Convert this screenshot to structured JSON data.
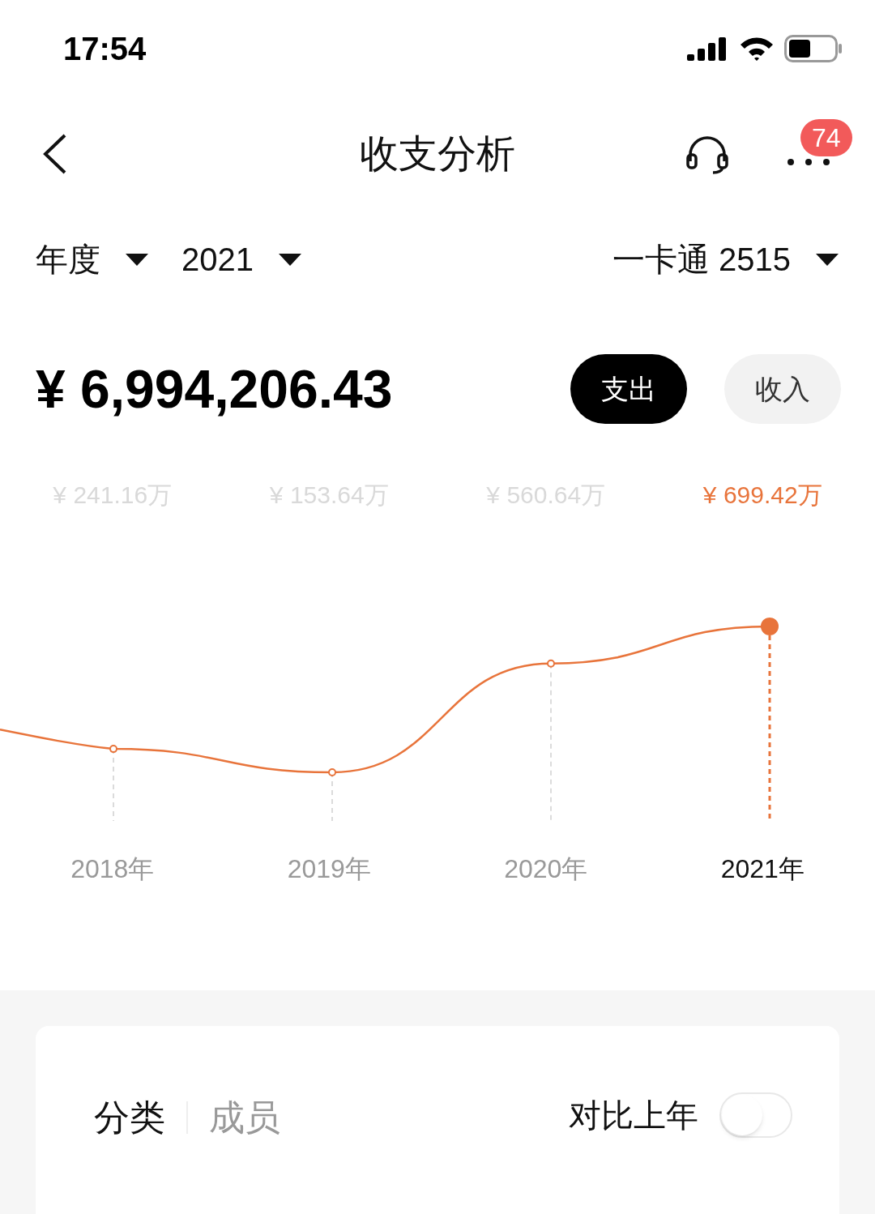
{
  "status_bar": {
    "time": "17:54"
  },
  "header": {
    "title": "收支分析",
    "badge": "74"
  },
  "filters": {
    "period": "年度",
    "year": "2021",
    "account": "一卡通 2515"
  },
  "total": {
    "amount": "¥ 6,994,206.43"
  },
  "type_buttons": [
    {
      "label": "支出",
      "selected": true
    },
    {
      "label": "收入",
      "selected": false
    }
  ],
  "chart": {
    "points": [
      {
        "value_label": "¥ 241.16万",
        "year": "2018年",
        "selected": false
      },
      {
        "value_label": "¥ 153.64万",
        "year": "2019年",
        "selected": false
      },
      {
        "value_label": "¥ 560.64万",
        "year": "2020年",
        "selected": false
      },
      {
        "value_label": "¥ 699.42万",
        "year": "2021年",
        "selected": true
      }
    ]
  },
  "card": {
    "tabs": [
      {
        "label": "分类",
        "selected": true
      },
      {
        "label": "成员",
        "selected": false
      }
    ],
    "compare": {
      "label": "对比上年",
      "on": false
    }
  }
}
